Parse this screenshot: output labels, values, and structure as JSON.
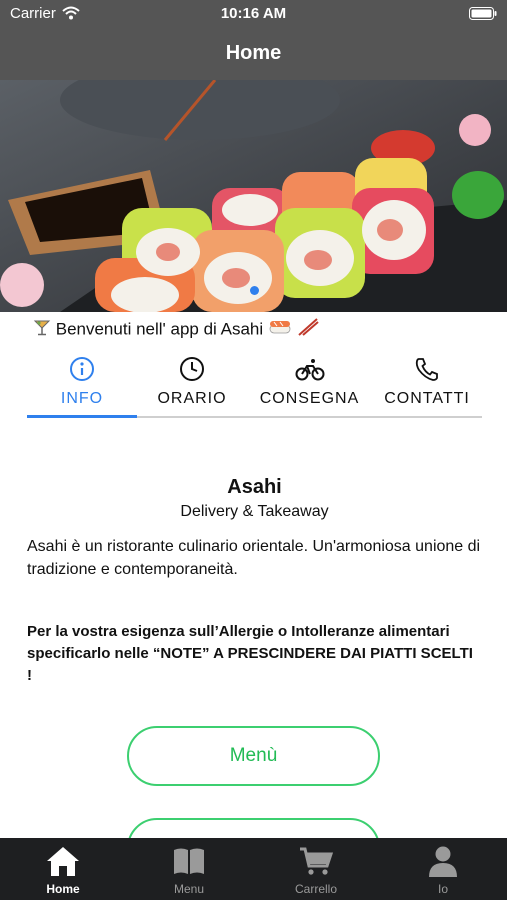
{
  "status_bar": {
    "carrier": "Carrier",
    "time": "10:16 AM",
    "icons": [
      "wifi-icon",
      "battery-icon"
    ]
  },
  "nav": {
    "title": "Home"
  },
  "hero": {
    "image": "sushi-rolls-photo",
    "carousel_dot": "active"
  },
  "welcome": {
    "leading_icon": "cocktail-icon",
    "text": "Benvenuti nell' app di Asahi",
    "trailing_icons": [
      "sushi-icon",
      "chopsticks-icon"
    ]
  },
  "tabs": [
    {
      "label": "INFO",
      "icon": "info-icon",
      "active": true
    },
    {
      "label": "ORARIO",
      "icon": "clock-icon",
      "active": false
    },
    {
      "label": "CONSEGNA",
      "icon": "bicycle-icon",
      "active": false
    },
    {
      "label": "CONTATTI",
      "icon": "phone-icon",
      "active": false
    }
  ],
  "info": {
    "name": "Asahi",
    "subtitle": "Delivery & Takeaway",
    "description": "Asahi è un ristorante culinario orientale. Un'armoniosa unione di tradizione e contemporaneità.",
    "allergy_notice": "Per la vostra esigenza sull’Allergie o Intolleranze alimentari specificarlo nelle “NOTE” A PRESCINDERE DAI PIATTI SCELTI !"
  },
  "buttons": {
    "menu": "Menù"
  },
  "tabbar": [
    {
      "label": "Home",
      "icon": "home-icon",
      "active": true
    },
    {
      "label": "Menu",
      "icon": "book-icon",
      "active": false
    },
    {
      "label": "Carrello",
      "icon": "cart-icon",
      "active": false
    },
    {
      "label": "Io",
      "icon": "person-icon",
      "active": false
    }
  ],
  "colors": {
    "header": "#555555",
    "accent_blue": "#2f80ed",
    "accent_green": "#3ccf70",
    "tabbar": "#1e1f21"
  }
}
